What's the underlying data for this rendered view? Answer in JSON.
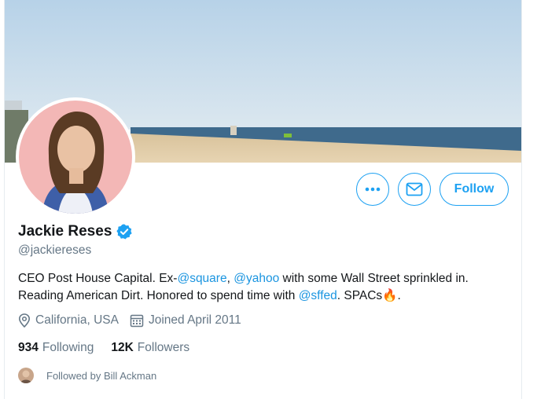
{
  "profile": {
    "name": "Jackie Reses",
    "handle": "@jackiereses",
    "bio": {
      "t1": "CEO Post House Capital. Ex-",
      "link1": "@square",
      "t2": ", ",
      "link2": "@yahoo",
      "t3": " with some Wall Street sprinkled in. Reading American Dirt. Honored to spend time with ",
      "link3": "@sffed",
      "t4": ". SPACs",
      "emoji": "🔥",
      "t5": "."
    },
    "location": "California, USA",
    "joined": "Joined April 2011",
    "following_count": "934",
    "following_label": "Following",
    "followers_count": "12K",
    "followers_label": "Followers",
    "followed_by": "Followed by Bill Ackman"
  },
  "actions": {
    "follow_label": "Follow",
    "more_icon": "more-icon",
    "message_icon": "envelope-icon"
  },
  "colors": {
    "accent": "#1da1f2",
    "link": "#1b95e0",
    "muted": "#657786"
  }
}
